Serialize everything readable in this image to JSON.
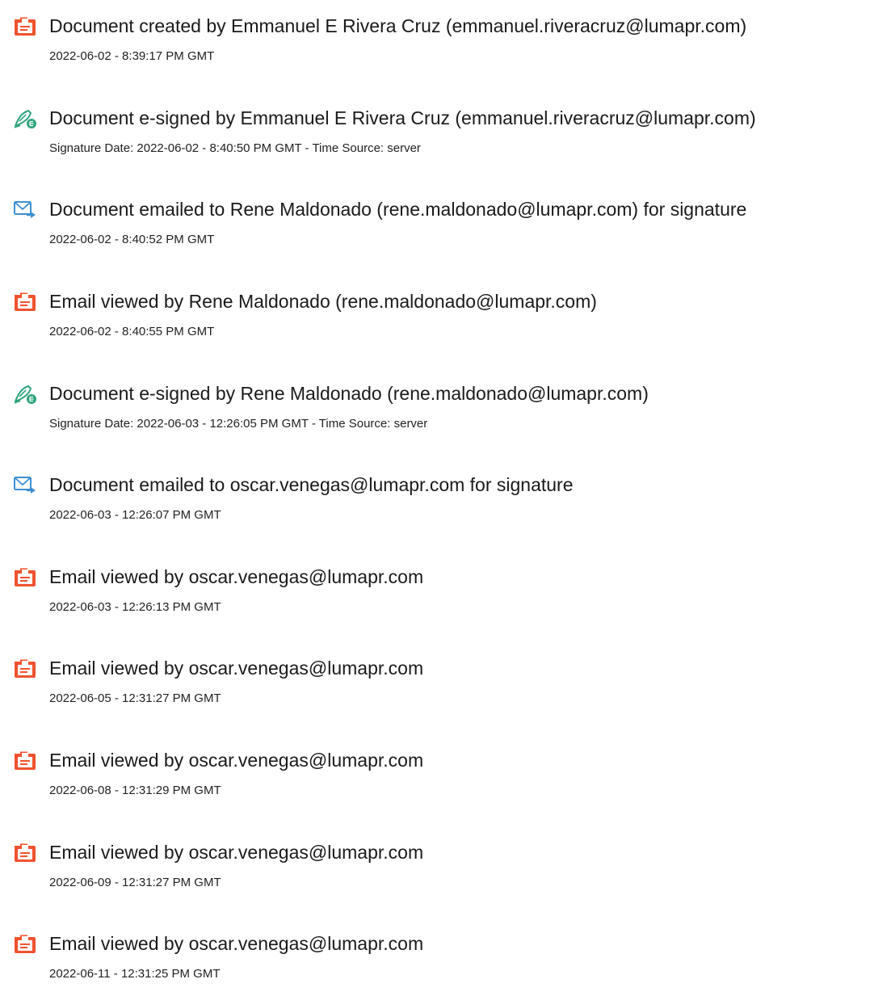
{
  "colors": {
    "view_icon": "#f0522e",
    "sign_icon": "#2ea37a",
    "email_icon": "#3d8fd1"
  },
  "events": [
    {
      "icon": "document-icon",
      "title": "Document created by Emmanuel E Rivera Cruz (emmanuel.riveracruz@lumapr.com)",
      "subtitle": "2022-06-02 - 8:39:17 PM GMT"
    },
    {
      "icon": "e-sign-pen-icon",
      "title": "Document e-signed by Emmanuel E Rivera Cruz (emmanuel.riveracruz@lumapr.com)",
      "subtitle": "Signature Date: 2022-06-02 - 8:40:50 PM GMT - Time Source: server"
    },
    {
      "icon": "email-sent-icon",
      "title": "Document emailed to Rene Maldonado (rene.maldonado@lumapr.com) for signature",
      "subtitle": "2022-06-02 - 8:40:52 PM GMT"
    },
    {
      "icon": "document-icon",
      "title": "Email viewed by Rene Maldonado (rene.maldonado@lumapr.com)",
      "subtitle": "2022-06-02 - 8:40:55 PM GMT"
    },
    {
      "icon": "e-sign-pen-icon",
      "title": "Document e-signed by Rene Maldonado (rene.maldonado@lumapr.com)",
      "subtitle": "Signature Date: 2022-06-03 - 12:26:05 PM GMT - Time Source: server"
    },
    {
      "icon": "email-sent-icon",
      "title": "Document emailed to oscar.venegas@lumapr.com for signature",
      "subtitle": "2022-06-03 - 12:26:07 PM GMT"
    },
    {
      "icon": "document-icon",
      "title": "Email viewed by oscar.venegas@lumapr.com",
      "subtitle": "2022-06-03 - 12:26:13 PM GMT"
    },
    {
      "icon": "document-icon",
      "title": "Email viewed by oscar.venegas@lumapr.com",
      "subtitle": "2022-06-05 - 12:31:27 PM GMT"
    },
    {
      "icon": "document-icon",
      "title": "Email viewed by oscar.venegas@lumapr.com",
      "subtitle": "2022-06-08 - 12:31:29 PM GMT"
    },
    {
      "icon": "document-icon",
      "title": "Email viewed by oscar.venegas@lumapr.com",
      "subtitle": "2022-06-09 - 12:31:27 PM GMT"
    },
    {
      "icon": "document-icon",
      "title": "Email viewed by oscar.venegas@lumapr.com",
      "subtitle": "2022-06-11 - 12:31:25 PM GMT"
    }
  ]
}
